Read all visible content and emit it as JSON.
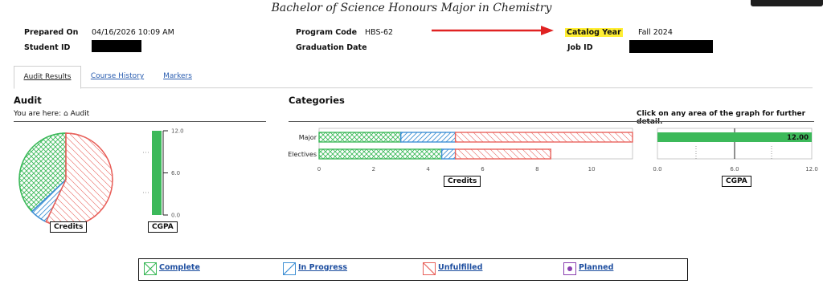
{
  "page": {
    "title": "Bachelor of Science Honours Major in Chemistry"
  },
  "header": {
    "prepared_on_label": "Prepared On",
    "prepared_on_value": "04/16/2026 10:09 AM",
    "program_code_label": "Program Code",
    "program_code_value": "HBS-62",
    "catalog_year_label": "Catalog Year",
    "catalog_year_value": "Fall 2024",
    "student_id_label": "Student ID",
    "graduation_date_label": "Graduation Date",
    "job_id_label": "Job ID"
  },
  "tabs": [
    {
      "label": "Audit Results"
    },
    {
      "label": "Course History"
    },
    {
      "label": "Markers"
    }
  ],
  "audit": {
    "heading": "Audit",
    "breadcrumb_prefix": "You are here:",
    "breadcrumb_item": "Audit",
    "credits_label": "Credits",
    "cgpa_label": "CGPA",
    "cgpa_ticks": [
      "12.0",
      "6.0",
      "0.0"
    ]
  },
  "categories": {
    "heading": "Categories",
    "hint": "Click on any area of the graph for further detail.",
    "credits_axis_label": "Credits",
    "cgpa_axis_label": "CGPA",
    "cgpa_value_label": "12.00",
    "cgpa_ticks": [
      "0.0",
      "6.0",
      "12.0"
    ]
  },
  "legend": {
    "complete": "Complete",
    "in_progress": "In Progress",
    "unfulfilled": "Unfulfilled",
    "planned": "Planned"
  },
  "colors": {
    "complete": "#3cb95a",
    "in_progress": "#3d8fd4",
    "unfulfilled": "#e8605a",
    "planned": "#8a3fb0",
    "arrow": "#e02222",
    "highlight": "#ffee33",
    "link": "#2a5db0"
  },
  "chart_data": [
    {
      "type": "pie",
      "xlabel": "Credits",
      "slices": [
        {
          "label": "Complete",
          "value": 37
        },
        {
          "label": "In Progress",
          "value": 6
        },
        {
          "label": "Unfulfilled",
          "value": 57
        }
      ]
    },
    {
      "type": "bar",
      "xlabel": "CGPA",
      "values": [
        12.0
      ],
      "ylim": [
        0,
        12
      ],
      "yticks": [
        "0.0",
        "6.0",
        "12.0"
      ]
    },
    {
      "type": "bar",
      "orientation": "horizontal",
      "stacked": true,
      "categories": [
        "Major",
        "Electives"
      ],
      "series": [
        {
          "name": "Complete",
          "values": [
            3,
            4.5
          ]
        },
        {
          "name": "In Progress",
          "values": [
            2,
            0.5
          ]
        },
        {
          "name": "Unfulfilled",
          "values": [
            6.5,
            3.5
          ]
        }
      ],
      "xlabel": "Credits",
      "xlim": [
        0,
        11.5
      ],
      "xticks": [
        0,
        2,
        4,
        6,
        8,
        10
      ]
    },
    {
      "type": "bar",
      "orientation": "horizontal",
      "values": [
        12.0
      ],
      "xlabel": "CGPA",
      "xlim": [
        0,
        12
      ],
      "xticks": [
        "0.0",
        "6.0",
        "12.0"
      ],
      "data_label": "12.00"
    }
  ]
}
